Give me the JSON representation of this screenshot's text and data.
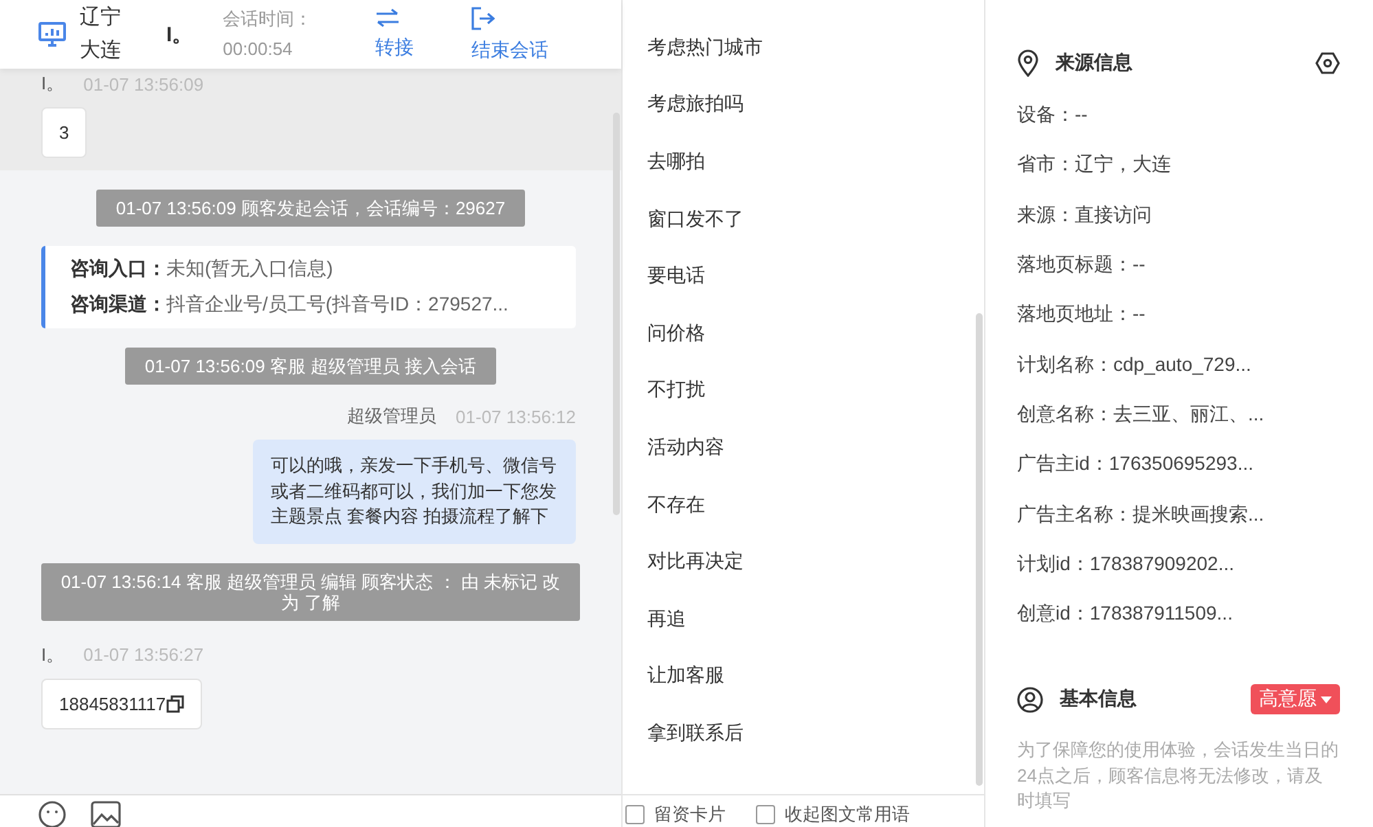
{
  "header": {
    "region": "辽宁大连",
    "visitor": "I。",
    "timer_label": "会话时间：",
    "timer_value": "00:00:54",
    "actions": [
      {
        "kind": "transfer",
        "label": "转接"
      },
      {
        "kind": "end",
        "label": "结束会话"
      }
    ]
  },
  "messages": [
    {
      "kind": "customer",
      "sender": "I。",
      "time": "01-07 13:56:09",
      "text": "3",
      "copyable": false,
      "highlighted": true
    },
    {
      "kind": "system",
      "text": "01-07 13:56:09 顾客发起会话，会话编号：29627"
    },
    {
      "kind": "info",
      "entries": [
        {
          "label": "咨询入口：",
          "value": "未知(暂无入口信息)"
        },
        {
          "label": "咨询渠道：",
          "value": "抖音企业号/员工号(抖音号ID：279527..."
        }
      ]
    },
    {
      "kind": "system",
      "text": "01-07 13:56:09 客服 超级管理员 接入会话"
    },
    {
      "kind": "agent",
      "sender": "超级管理员",
      "time": "01-07 13:56:12",
      "text": "可以的哦，亲发一下手机号、微信号或者二维码都可以，我们加一下您发主题景点 套餐内容 拍摄流程了解下"
    },
    {
      "kind": "system",
      "text": "01-07 13:56:14 客服 超级管理员 编辑 顾客状态 ： 由 未标记 改为 了解"
    },
    {
      "kind": "customer",
      "sender": "I。",
      "time": "01-07 13:56:27",
      "text": "18845831117",
      "copyable": true,
      "highlighted": false
    }
  ],
  "quick_replies": [
    "考虑热门城市",
    "考虑旅拍吗",
    "去哪拍",
    "窗口发不了",
    "要电话",
    "问价格",
    "不打扰",
    "活动内容",
    "不存在",
    "对比再决定",
    "再追",
    "让加客服",
    "拿到联系后"
  ],
  "quick_options": [
    {
      "label": "留资卡片",
      "checked": false
    },
    {
      "label": "收起图文常用语",
      "checked": false
    }
  ],
  "source_info": {
    "title": "来源信息",
    "items": [
      "设备：--",
      "省市：辽宁，大连",
      "来源：直接访问",
      "落地页标题：--",
      "落地页地址：--",
      "计划名称：cdp_auto_729...",
      "创意名称：去三亚、丽江、...",
      "广告主id：176350695293...",
      "广告主名称：提米映画搜索...",
      "计划id：178387909202...",
      "创意id：178387911509..."
    ]
  },
  "basic_info": {
    "title": "基本信息",
    "tag": {
      "label": "高意愿",
      "color": "#f0505a"
    },
    "note": "为了保障您的使用体验，会话发生当日的24点之后，顾客信息将无法修改，请及时填写"
  }
}
